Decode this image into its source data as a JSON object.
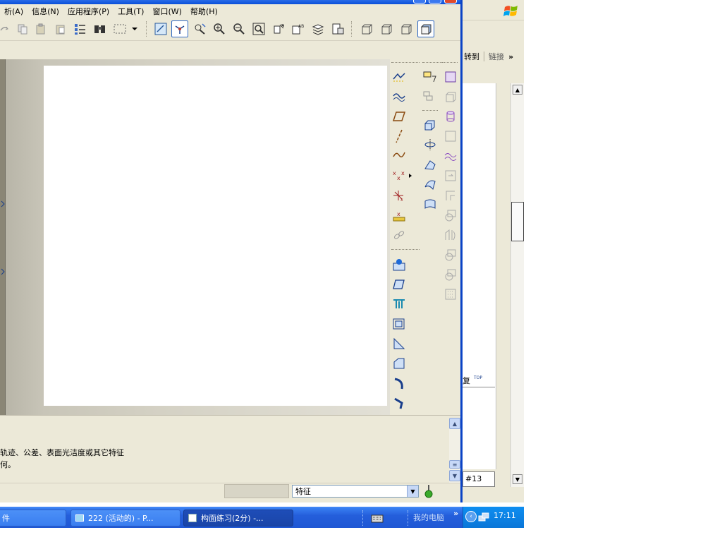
{
  "menu": {
    "items": [
      "析(A)",
      "信息(N)",
      "应用程序(P)",
      "工具(T)",
      "窗口(W)",
      "帮助(H)"
    ]
  },
  "message_area": {
    "line1": "轨迹、公差、表面光洁度或其它特征",
    "line2": "何。"
  },
  "statusbar": {
    "filter_value": "特征"
  },
  "browser": {
    "links_goto": "转到",
    "links_label": "链接",
    "links_more": "»",
    "footer_fragment": "复",
    "top_link": "TOP",
    "status_box": "#13"
  },
  "taskbar": {
    "button1": "件",
    "button2": "222 (活动的) - P...",
    "button3": "构面练习(2分) -...",
    "button4": "我的电脑",
    "chevron": "»",
    "clock": "17:11"
  },
  "colors": {
    "window_border": "#0a43c6",
    "taskbar_blue": "#245edb",
    "tray_blue": "#0f8ef0",
    "face": "#ece9d8"
  }
}
